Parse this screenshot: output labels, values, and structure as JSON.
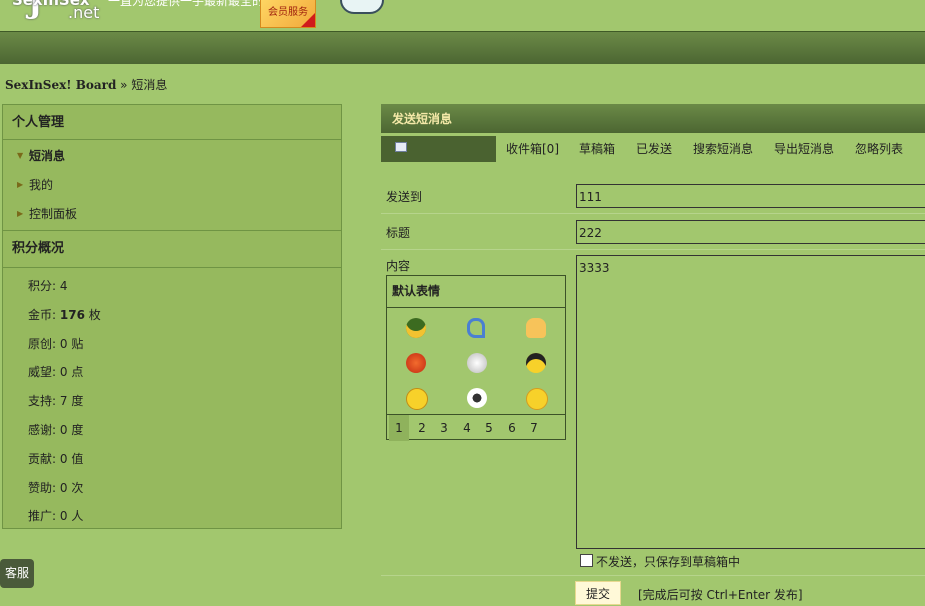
{
  "header": {
    "logo_main": "SexInSex",
    "logo_j": "J",
    "logo_suffix": ".net",
    "slogan": "一直为您提供一手最新最全的",
    "vip_label": "会员服务"
  },
  "breadcrumb": {
    "site": "SexInSex! Board",
    "separator": "»",
    "current": "短消息"
  },
  "sidebar": {
    "section1_title": "个人管理",
    "items": [
      {
        "label": "短消息",
        "active": true
      },
      {
        "label": "我的",
        "active": false
      },
      {
        "label": "控制面板",
        "active": false
      }
    ],
    "section2_title": "积分概况",
    "stats": [
      {
        "label": "积分:",
        "value": "4",
        "unit": ""
      },
      {
        "label": "金币:",
        "value": "176",
        "unit": "枚"
      },
      {
        "label": "原创:",
        "value": "0",
        "unit": "贴"
      },
      {
        "label": "威望:",
        "value": "0",
        "unit": "点"
      },
      {
        "label": "支持:",
        "value": "7",
        "unit": "度"
      },
      {
        "label": "感谢:",
        "value": "0",
        "unit": "度"
      },
      {
        "label": "贡献:",
        "value": "0",
        "unit": "值"
      },
      {
        "label": "赞助:",
        "value": "0",
        "unit": "次"
      },
      {
        "label": "推广:",
        "value": "0",
        "unit": "人"
      }
    ],
    "kefu_label": "客服"
  },
  "main": {
    "title": "发送短消息",
    "tabs": [
      "收件箱[0]",
      "草稿箱",
      "已发送",
      "搜索短消息",
      "导出短消息",
      "忽略列表"
    ],
    "form": {
      "to_label": "发送到",
      "to_value": "111",
      "subject_label": "标题",
      "subject_value": "222",
      "content_label": "内容",
      "content_value": "3333"
    },
    "smilies": {
      "title": "默认表情",
      "pages": [
        "1",
        "2",
        "3",
        "4",
        "5",
        "6",
        "7"
      ],
      "active_page": "1"
    },
    "save_draft_label": "不发送，只保存到草稿箱中",
    "submit_label": "提交",
    "hint": "[完成后可按 Ctrl+Enter 发布]"
  },
  "colors": {
    "page_bg": "#a2c76e",
    "bar_dark": "#4c6632",
    "title_text": "#f4e9a8"
  }
}
